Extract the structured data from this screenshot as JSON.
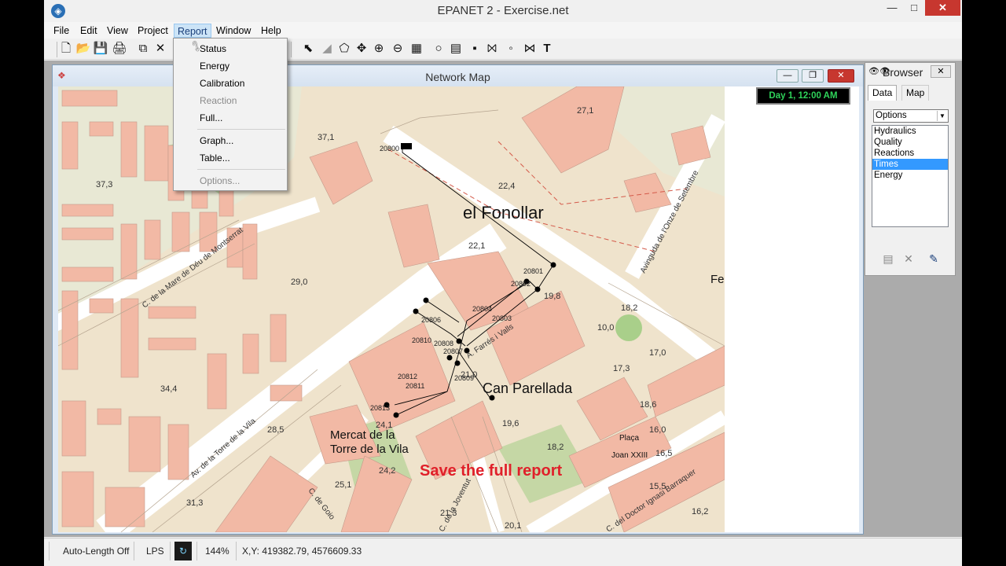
{
  "window": {
    "title": "EPANET 2 - Exercise.net",
    "min_icon": "minimize-icon",
    "max_icon": "maximize-icon",
    "close_icon": "close-icon"
  },
  "menubar": {
    "items": [
      "File",
      "Edit",
      "View",
      "Project",
      "Report",
      "Window",
      "Help"
    ]
  },
  "report_menu": {
    "items": [
      {
        "label": "Status",
        "enabled": true
      },
      {
        "label": "Energy",
        "enabled": true
      },
      {
        "label": "Calibration",
        "enabled": true
      },
      {
        "label": "Reaction",
        "enabled": false
      },
      {
        "label": "Full...",
        "enabled": true
      },
      {
        "label": "Graph...",
        "enabled": true
      },
      {
        "label": "Table...",
        "enabled": true
      },
      {
        "label": "Options...",
        "enabled": false
      }
    ]
  },
  "toolbar": {
    "icons": [
      "new-icon",
      "open-icon",
      "save-icon",
      "print-icon",
      "copy-icon",
      "delete-icon",
      "select-object-icon",
      "select-vertex-icon",
      "select-region-icon",
      "pan-icon",
      "zoom-in-icon",
      "zoom-out-icon",
      "full-extent-icon",
      "add-junction-icon",
      "add-reservoir-icon",
      "add-tank-icon",
      "add-pipe-icon",
      "add-pump-icon",
      "add-valve-icon",
      "add-label-icon"
    ]
  },
  "map_window": {
    "title": "Network Map",
    "clock": "Day 1, 12:00 AM"
  },
  "map": {
    "place_names": [
      "el Fonollar",
      "Can Parellada",
      "Mercat de la",
      "Torre de la Vila",
      "Fe",
      "Plaça",
      "Joan XXIII"
    ],
    "streets": [
      "C. de la Mare de Déu de Montserrat",
      "Avinguda de l'Onze de Setembre",
      "Av. de la Torre de la Vila",
      "A. Farrés i Valls",
      "C. de Goio",
      "C. de la Joventut",
      "C. del Doctor Ignasi Barraquer"
    ],
    "elevations": [
      "27,1",
      "37,1",
      "22,4",
      "22,1",
      "37,3",
      "29,0",
      "19,8",
      "18,2",
      "10,0",
      "17,0",
      "17,3",
      "34,4",
      "21,0",
      "19,6",
      "18,6",
      "16,0",
      "16,5",
      "16,2",
      "15,5",
      "24,1",
      "24,2",
      "28,5",
      "25,1",
      "31,3",
      "21,3",
      "20,1",
      "18,2"
    ],
    "node_ids": [
      "20800",
      "20801",
      "20802",
      "20803",
      "20804",
      "20806",
      "20807",
      "20808",
      "20809",
      "20810",
      "20811",
      "20812",
      "20813"
    ],
    "annotation": "Save the full report"
  },
  "browser": {
    "title": "Browser",
    "tabs": [
      "Data",
      "Map"
    ],
    "category": "Options",
    "items": [
      "Hydraulics",
      "Quality",
      "Reactions",
      "Times",
      "Energy"
    ],
    "selected": "Times"
  },
  "statusbar": {
    "auto_length": "Auto-Length Off",
    "units": "LPS",
    "zoom": "144%",
    "xy": "X,Y: 419382.79, 4576609.33"
  },
  "colors": {
    "block": "#f2b9a5",
    "green": "#a9cf8a",
    "ground": "#efe3cc",
    "annotation": "#e0202a",
    "clock_text": "#2fd35a"
  }
}
